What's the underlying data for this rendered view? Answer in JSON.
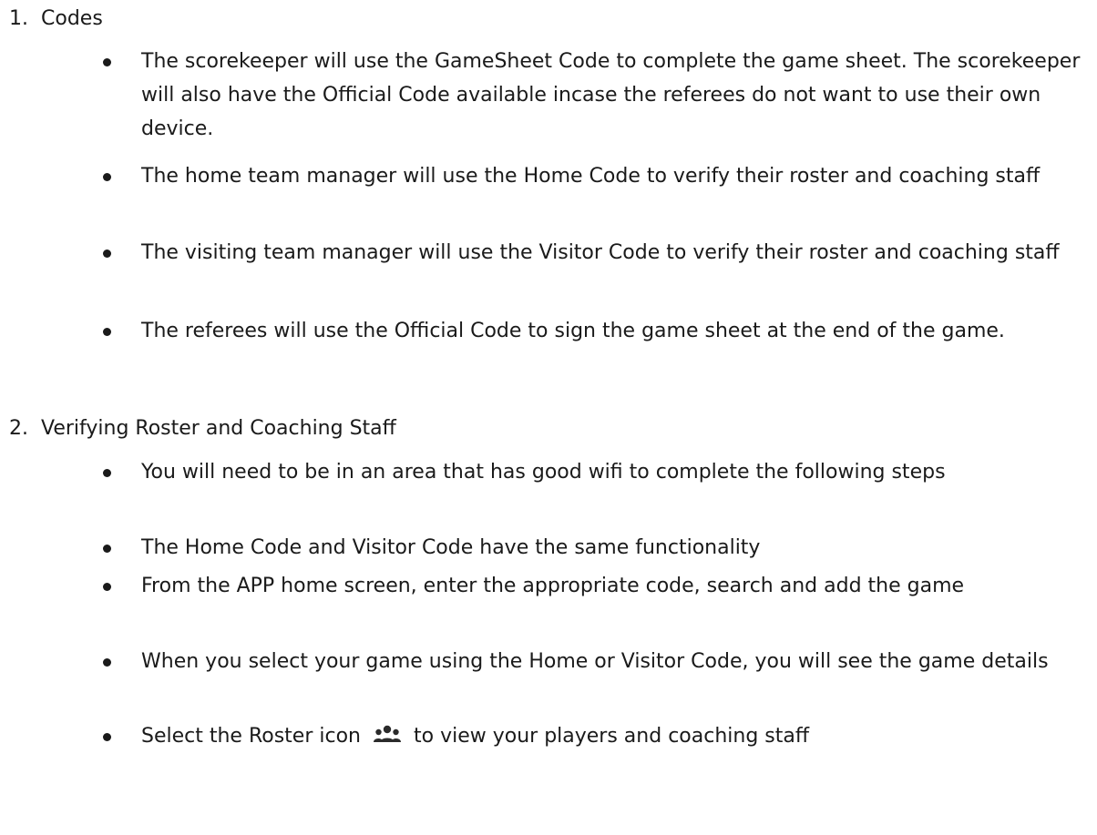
{
  "sections": [
    {
      "number": "1.",
      "title": "Codes",
      "bullets": [
        "The scorekeeper will use the GameSheet Code to complete the game sheet. The scorekeeper will also have the Official Code available incase the referees do not want to use their own device.",
        "The home team manager will use the Home Code to verify their roster and coaching staff",
        "The visiting team manager will use the Visitor Code to verify their roster and coaching staff",
        "The referees will use the Official Code to sign the game sheet at the end of the game."
      ]
    },
    {
      "number": "2.",
      "title": "Verifying Roster and Coaching Staff",
      "bullets": [
        "You will need to be in an area that has good wifi to complete the following steps",
        "The Home Code and Visitor Code have the same functionality",
        "From the APP home screen, enter the appropriate code, search and add the game",
        "When you select your game using the Home or Visitor Code, you will see the game details"
      ],
      "last_bullet": {
        "before_icon": "Select the Roster icon",
        "icon": "group-icon",
        "after_icon": "to view your players and coaching staff"
      }
    }
  ]
}
